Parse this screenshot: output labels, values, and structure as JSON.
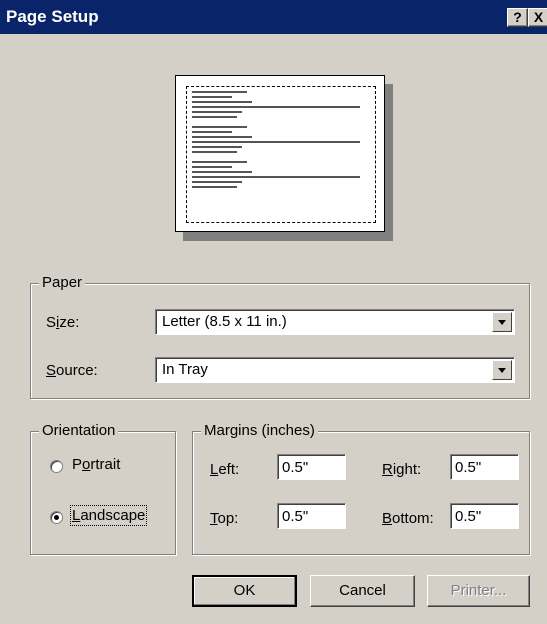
{
  "title": "Page Setup",
  "titlebar": {
    "help": "?",
    "close": "X"
  },
  "paper": {
    "legend": "Paper",
    "size_label": "Size:",
    "size_value": "Letter (8.5 x 11 in.)",
    "source_label": "Source:",
    "source_value": "In Tray"
  },
  "orientation": {
    "legend": "Orientation",
    "portrait": "Portrait",
    "landscape": "Landscape",
    "selected": "landscape"
  },
  "margins": {
    "legend": "Margins (inches)",
    "left_label": "Left:",
    "left_value": "0.5\"",
    "right_label": "Right:",
    "right_value": "0.5\"",
    "top_label": "Top:",
    "top_value": "0.5\"",
    "bottom_label": "Bottom:",
    "bottom_value": "0.5\""
  },
  "buttons": {
    "ok": "OK",
    "cancel": "Cancel",
    "printer": "Printer..."
  },
  "colors": {
    "titlebar": "#0a246a",
    "face": "#d4d0c8"
  }
}
